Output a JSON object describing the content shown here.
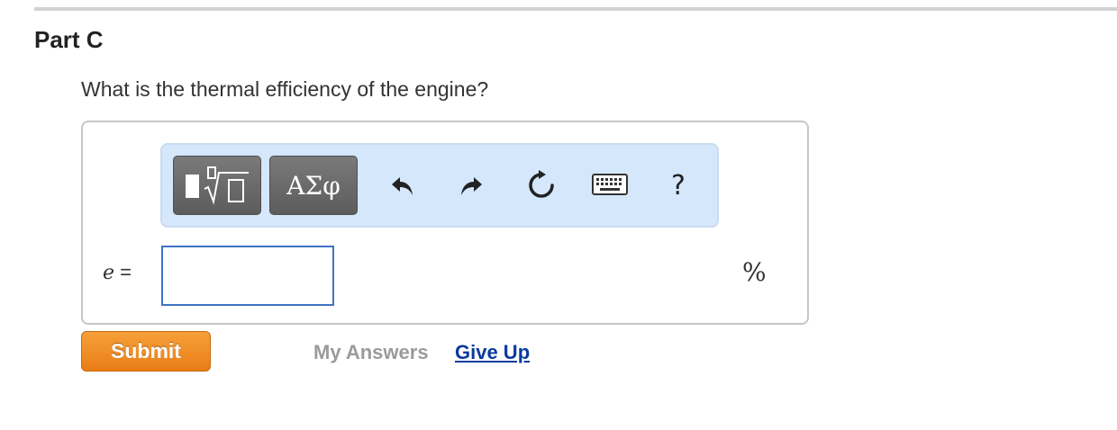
{
  "part": {
    "title": "Part C",
    "question": "What is the thermal efficiency of the engine?"
  },
  "toolbar": {
    "template_icon": "fraction-root-template-icon",
    "greek_label": "ΑΣφ",
    "undo_icon": "undo-arrow-icon",
    "redo_icon": "redo-arrow-icon",
    "reset_icon": "reset-circular-arrow-icon",
    "keyboard_icon": "keyboard-icon",
    "help_label": "?"
  },
  "answer": {
    "variable": "e",
    "equals": "=",
    "value": "",
    "unit": "%"
  },
  "actions": {
    "submit_label": "Submit",
    "my_answers_label": "My Answers",
    "give_up_label": "Give Up"
  },
  "colors": {
    "toolbar_bg": "#d4e7fb",
    "submit_orange": "#ea7d17",
    "link_blue": "#0b3a9e",
    "input_border": "#3f73c2"
  }
}
